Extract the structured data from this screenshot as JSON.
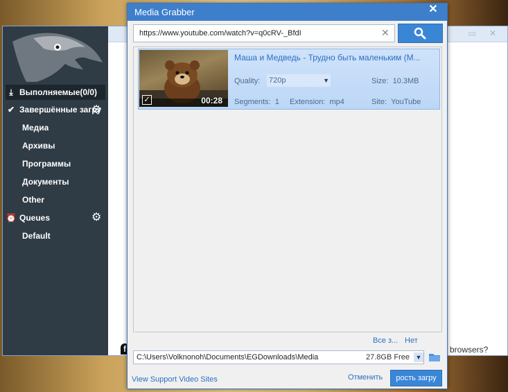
{
  "background_app": {
    "sidebar": {
      "items": [
        {
          "label": "Выполняемые(0/0)",
          "icon": "download-icon"
        },
        {
          "label": "Завершённые загру",
          "icon": "check-circle-icon"
        },
        {
          "label": "Медиа"
        },
        {
          "label": "Архивы"
        },
        {
          "label": "Программы"
        },
        {
          "label": "Документы"
        },
        {
          "label": "Other"
        },
        {
          "label": "Queues",
          "icon": "clock-icon"
        },
        {
          "label": "Default"
        }
      ]
    },
    "bottom_text": "browsers?"
  },
  "dialog": {
    "title": "Media Grabber",
    "url": "https://www.youtube.com/watch?v=q0cRV-_BfdI",
    "video": {
      "title": "Маша и Медведь - Трудно быть маленьким (М...",
      "duration": "00:28",
      "quality_label": "Quality:",
      "quality_value": "720p",
      "size_label": "Size:",
      "size_value": "10.3MB",
      "segments_label": "Segments:",
      "segments_value": "1",
      "extension_label": "Extension:",
      "extension_value": "mp4",
      "site_label": "Site:",
      "site_value": "YouTube"
    },
    "select_all": "Все з...",
    "select_none": "Нет",
    "save_path": "C:\\Users\\Volknonoh\\Documents\\EGDownloads\\Media",
    "free_space": "27.8GB Free",
    "support_link": "View Support Video Sites",
    "cancel_label": "Отменить",
    "start_label": "рость загру"
  },
  "colors": {
    "accent": "#3e7fcc",
    "sidebar_bg": "#2f3b45",
    "selected_row": "#c4dcf8",
    "link": "#2a6fc2"
  }
}
